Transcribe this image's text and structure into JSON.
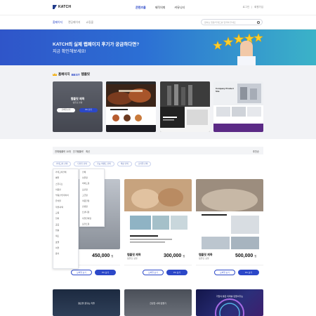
{
  "header": {
    "logo": "KATCH",
    "nav": [
      "콘텐츠몰",
      "제작의뢰",
      "커뮤니티"
    ],
    "util": [
      "로그인",
      "회원가입"
    ]
  },
  "subnav": {
    "tabs": [
      "홈페이지",
      "랜딩페이지",
      "쇼핑몰"
    ],
    "search_placeholder": "원하는 업종/키워드를 입력해 주세요"
  },
  "banner": {
    "title": "KATCH의 실제 랩페이지 후기가 궁금하다면?",
    "subtitle": "지금 확인해보세요!"
  },
  "best": {
    "title_prefix": "홈페이지",
    "title_accent": "BEST",
    "title_suffix": "템플릿",
    "card1": {
      "title": "템플릿 제목",
      "subtitle": "템플릿 설명",
      "btn_demo": "모바일 보기",
      "btn_pc": "PC 보기"
    },
    "card4": {
      "title": "Company Product Site"
    }
  },
  "filter": {
    "total_label": "전체템플릿 10개",
    "sort1": "인기템플릿",
    "sort2": "최신",
    "right_sort": "추천순",
    "chips": [
      "카테고리 선택",
      "디자인 선택",
      "기능·이벤트 선택",
      "색상 선택",
      "스타일 선택"
    ]
  },
  "dropdown1": [
    "카테고리전체",
    "병원",
    "스튜디오",
    "미용실",
    "부동산/인테리어",
    "유치원",
    "학원/과외",
    "교육",
    "협회",
    "공공",
    "법률",
    "제조",
    "호텔",
    "여행",
    "음식"
  ],
  "dropdown2": [
    "전체",
    "심플형",
    "비비드형",
    "모던형",
    "고급형",
    "따뜻한형",
    "감성형",
    "트렌디형",
    "자연친화형",
    "포인트형"
  ],
  "products": [
    {
      "name": "템플릿 제목",
      "desc": "템플릿 설명",
      "price": "450,000",
      "won": "원",
      "btn_demo": "모바일 보기",
      "btn_pc": "PC 보기"
    },
    {
      "name": "템플릿 제목",
      "desc": "템플릿 설명",
      "price": "300,000",
      "won": "원",
      "btn_demo": "모바일 보기",
      "btn_pc": "PC 보기"
    },
    {
      "name": "템플릿 제목",
      "desc": "템플릿 설명",
      "price": "500,000",
      "won": "원",
      "btn_demo": "모바일 보기",
      "btn_pc": "PC 보기"
    }
  ],
  "bottom_cards": [
    "결혼을 꿈꾸는 커플",
    "건강한 사회 만들기",
    "기업의 밝은 미래를 만들어가는"
  ],
  "colors": {
    "accent": "#2c48c8",
    "banner_start": "#2f55c9",
    "banner_end": "#3bb3c8"
  }
}
